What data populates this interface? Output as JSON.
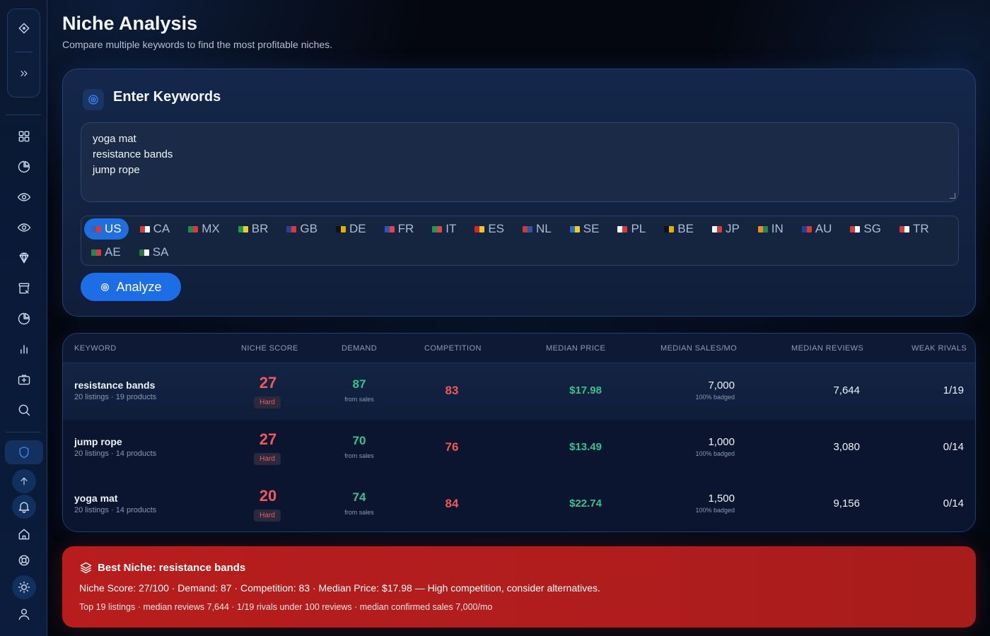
{
  "header": {
    "title": "Niche Analysis",
    "subtitle": "Compare multiple keywords to find the most profitable niches."
  },
  "sidebar": {
    "top": [
      "diamond-icon",
      "chevrons-right-icon"
    ],
    "items": [
      "grid-icon",
      "pie-chart-icon",
      "eye-icon",
      "eye-icon",
      "gem-icon",
      "box-remove-icon",
      "pie-chart-icon",
      "bar-chart-icon",
      "briefcase-plus-icon",
      "search-icon"
    ],
    "bottom": [
      "shield-icon",
      "arrow-up-icon",
      "bell-icon",
      "home-icon",
      "lifebuoy-icon",
      "sun-icon",
      "user-icon"
    ]
  },
  "keywords_card": {
    "title": "Enter Keywords",
    "keywords": [
      "yoga mat",
      "resistance bands",
      "jump rope"
    ],
    "markets": [
      {
        "code": "US",
        "selected": true
      },
      {
        "code": "CA"
      },
      {
        "code": "MX"
      },
      {
        "code": "BR"
      },
      {
        "code": "GB"
      },
      {
        "code": "DE"
      },
      {
        "code": "FR"
      },
      {
        "code": "IT"
      },
      {
        "code": "ES"
      },
      {
        "code": "NL"
      },
      {
        "code": "SE"
      },
      {
        "code": "PL"
      },
      {
        "code": "BE"
      },
      {
        "code": "JP"
      },
      {
        "code": "IN"
      },
      {
        "code": "AU"
      },
      {
        "code": "SG"
      },
      {
        "code": "TR"
      },
      {
        "code": "AE"
      },
      {
        "code": "SA"
      }
    ],
    "analyze_label": "Analyze"
  },
  "table": {
    "columns": [
      "KEYWORD",
      "NICHE SCORE",
      "DEMAND",
      "COMPETITION",
      "MEDIAN PRICE",
      "MEDIAN SALES/MO",
      "MEDIAN REVIEWS",
      "WEAK RIVALS"
    ],
    "rows": [
      {
        "keyword": "resistance bands",
        "meta": "20 listings · 19 products",
        "score": "27",
        "score_label": "Hard",
        "demand": "87",
        "demand_sub": "from sales",
        "competition": "83",
        "price": "$17.98",
        "sales": "7,000",
        "sales_sub": "100% badged",
        "reviews": "7,644",
        "rivals": "1/19"
      },
      {
        "keyword": "jump rope",
        "meta": "20 listings · 14 products",
        "score": "27",
        "score_label": "Hard",
        "demand": "70",
        "demand_sub": "from sales",
        "competition": "76",
        "price": "$13.49",
        "sales": "1,000",
        "sales_sub": "100% badged",
        "reviews": "3,080",
        "rivals": "0/14"
      },
      {
        "keyword": "yoga mat",
        "meta": "20 listings · 14 products",
        "score": "20",
        "score_label": "Hard",
        "demand": "74",
        "demand_sub": "from sales",
        "competition": "84",
        "price": "$22.74",
        "sales": "1,500",
        "sales_sub": "100% badged",
        "reviews": "9,156",
        "rivals": "0/14"
      }
    ]
  },
  "best_niche": {
    "title": "Best Niche: resistance bands",
    "line1": "Niche Score: 27/100 · Demand: 87 · Competition: 83 · Median Price: $17.98 — High competition, consider alternatives.",
    "line2": "Top 19 listings · median reviews 7,644 · 1/19 rivals under 100 reviews · median confirmed sales 7,000/mo"
  },
  "colors": {
    "accent": "#1d6ee6",
    "bad": "#f0585c",
    "good": "#34c38f",
    "banner": "#b81d1d"
  }
}
